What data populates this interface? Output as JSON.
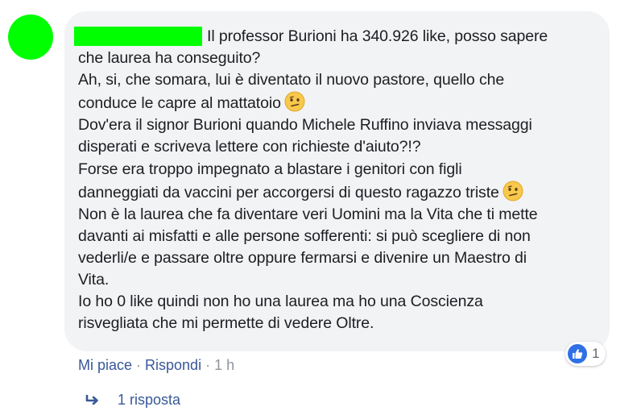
{
  "comment": {
    "lines": [
      "Il professor Burioni ha 340.926 like, posso sapere",
      "che laurea ha conseguito?",
      "Ah, si, che somara, lui è diventato il nuovo pastore, quello che",
      "conduce le capre al mattatoio",
      "Dov'era il signor Burioni quando Michele Ruffino inviava messaggi",
      "disperati e scriveva lettere con richieste d'aiuto?!?",
      "Forse era troppo impegnato a blastare i genitori con figli",
      "danneggiati da vaccini per accorgersi di questo ragazzo triste",
      "Non è la laurea che fa diventare veri Uomini ma la Vita che ti mette",
      "davanti ai misfatti e alle persone sofferenti: si può scegliere di non",
      "vederli/e e passare oltre oppure fermarsi e divenire un Maestro di",
      "Vita.",
      "Io ho 0 like quindi non ho una laurea ma ho una Coscienza",
      "risvegliata che mi permette di vedere Oltre."
    ]
  },
  "reactions": {
    "count": "1",
    "icon": "thumbs-up-icon",
    "color": "#2f70e6"
  },
  "actions": {
    "like": "Mi piace",
    "separator1": " · ",
    "reply": "Rispondi",
    "separator2": " · ",
    "time": "1 h"
  },
  "replies": {
    "label": "1 risposta"
  },
  "colors": {
    "avatar": "#00ff00",
    "name_redaction": "#00ff00",
    "link": "#385898",
    "bubble": "#f2f3f5"
  }
}
